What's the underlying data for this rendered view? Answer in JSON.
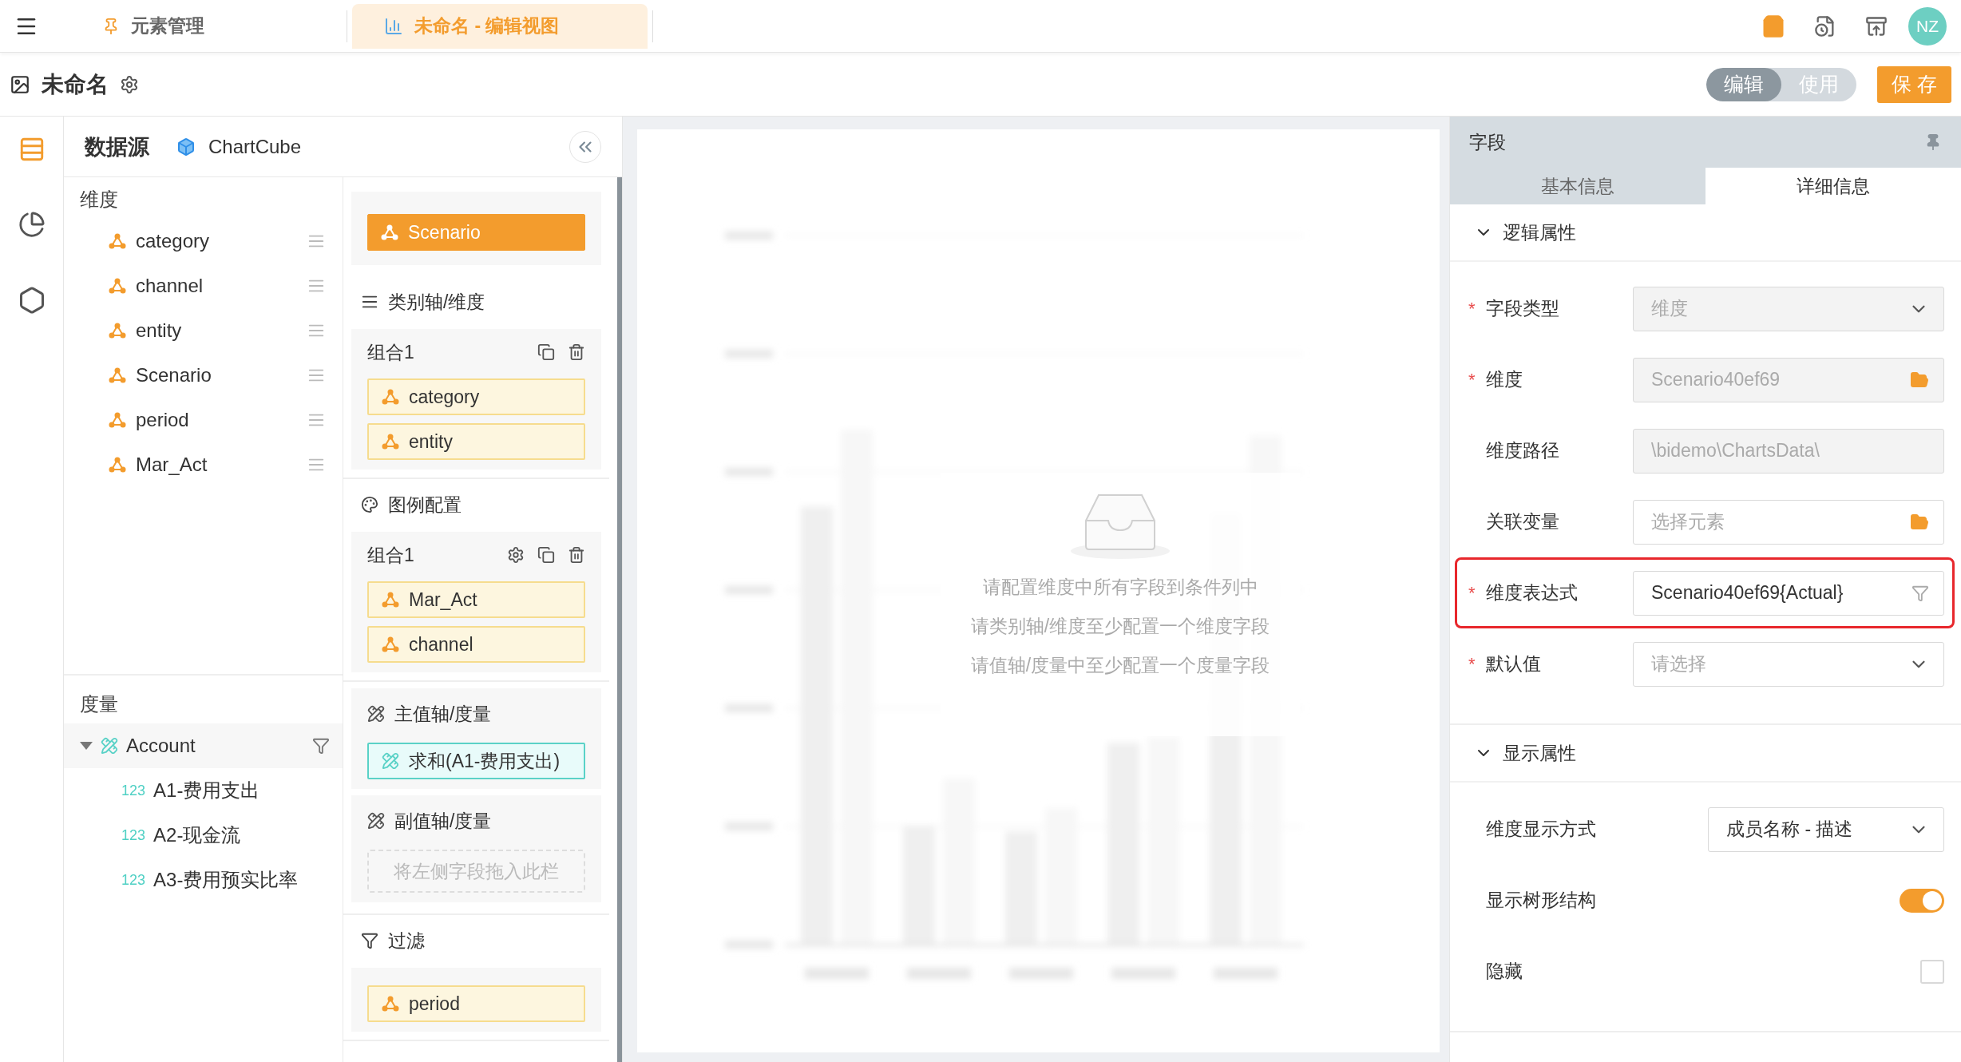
{
  "top_bar": {
    "tabs": [
      {
        "label": "元素管理",
        "selected": false
      },
      {
        "label": "未命名 - 编辑视图",
        "selected": true
      }
    ],
    "avatar": "NZ"
  },
  "title_bar": {
    "title": "未命名",
    "mode_toggle": [
      {
        "label": "编辑",
        "selected": true
      },
      {
        "label": "使用",
        "selected": false
      }
    ],
    "save_button": "保 存"
  },
  "rail": [
    {
      "kind": "list",
      "selected": true
    },
    {
      "kind": "pie",
      "selected": false
    },
    {
      "kind": "js",
      "selected": false
    }
  ],
  "data_source": {
    "title": "数据源",
    "source": "ChartCube",
    "dimensions": {
      "heading": "维度",
      "items": [
        "category",
        "channel",
        "entity",
        "Scenario",
        "period",
        "Mar_Act"
      ]
    },
    "measures": {
      "heading": "度量",
      "tree": [
        {
          "label": "Account",
          "expanded": true,
          "children": [
            {
              "badge": "123",
              "label": "A1-费用支出"
            },
            {
              "badge": "123",
              "label": "A2-现金流"
            },
            {
              "badge": "123",
              "label": "A3-费用预实比率"
            }
          ]
        }
      ]
    }
  },
  "config": {
    "pinned": {
      "label": "Scenario",
      "kind": "active"
    },
    "sections": [
      {
        "kind": "category",
        "title": "类别轴/维度",
        "groups": [
          {
            "title": "组合1",
            "settings": false,
            "fields": [
              {
                "label": "category",
                "kind": "dimension"
              },
              {
                "label": "entity",
                "kind": "dimension"
              }
            ]
          }
        ]
      },
      {
        "kind": "legend",
        "title": "图例配置",
        "groups": [
          {
            "title": "组合1",
            "settings": true,
            "fields": [
              {
                "label": "Mar_Act",
                "kind": "dimension"
              },
              {
                "label": "channel",
                "kind": "dimension"
              }
            ]
          }
        ]
      },
      {
        "kind": "measure",
        "title": "主值轴/度量",
        "fields": [
          {
            "label": "求和(A1-费用支出)",
            "kind": "measure"
          }
        ]
      },
      {
        "kind": "measure",
        "title": "副值轴/度量",
        "placeholder": "将左侧字段拖入此栏"
      },
      {
        "kind": "filter",
        "title": "过滤",
        "fields": [
          {
            "label": "period",
            "kind": "dimension"
          }
        ]
      }
    ]
  },
  "chart": {
    "empty_messages": [
      "请配置维度中所有字段到条件列中",
      "请类别轴/维度至少配置一个维度字段",
      "请值轴/度量中至少配置一个度量字段"
    ]
  },
  "field_panel": {
    "title": "字段",
    "tabs": [
      {
        "label": "基本信息",
        "selected": false
      },
      {
        "label": "详细信息",
        "selected": true
      }
    ],
    "sections": [
      {
        "title": "逻辑属性",
        "expanded": true,
        "rows": [
          {
            "kind": "select",
            "required_mark": "*",
            "label": "字段类型",
            "value": "维度",
            "disabled": true,
            "highlighted": false
          },
          {
            "kind": "picker",
            "required_mark": "*",
            "label": "维度",
            "value": "Scenario40ef69",
            "disabled": true,
            "highlighted": false
          },
          {
            "kind": "text",
            "label": "维度路径",
            "value": "\\bidemo\\ChartsData\\",
            "disabled": true,
            "highlighted": false
          },
          {
            "kind": "picker",
            "label": "关联变量",
            "placeholder": "选择元素",
            "disabled": false,
            "highlighted": false
          },
          {
            "kind": "filter",
            "required_mark": "*",
            "label": "维度表达式",
            "value": "Scenario40ef69{Actual}",
            "disabled": false,
            "highlighted": true
          },
          {
            "kind": "select",
            "required_mark": "*",
            "label": "默认值",
            "placeholder": "请选择",
            "disabled": false,
            "highlighted": false
          }
        ]
      },
      {
        "title": "显示属性",
        "expanded": true,
        "rows": [
          {
            "kind": "select",
            "label": "维度显示方式",
            "value": "成员名称 - 描述",
            "disabled": false
          },
          {
            "kind": "switch",
            "label": "显示树形结构",
            "on": true
          },
          {
            "kind": "checkbox",
            "label": "隐藏",
            "checked": false
          }
        ]
      }
    ]
  }
}
